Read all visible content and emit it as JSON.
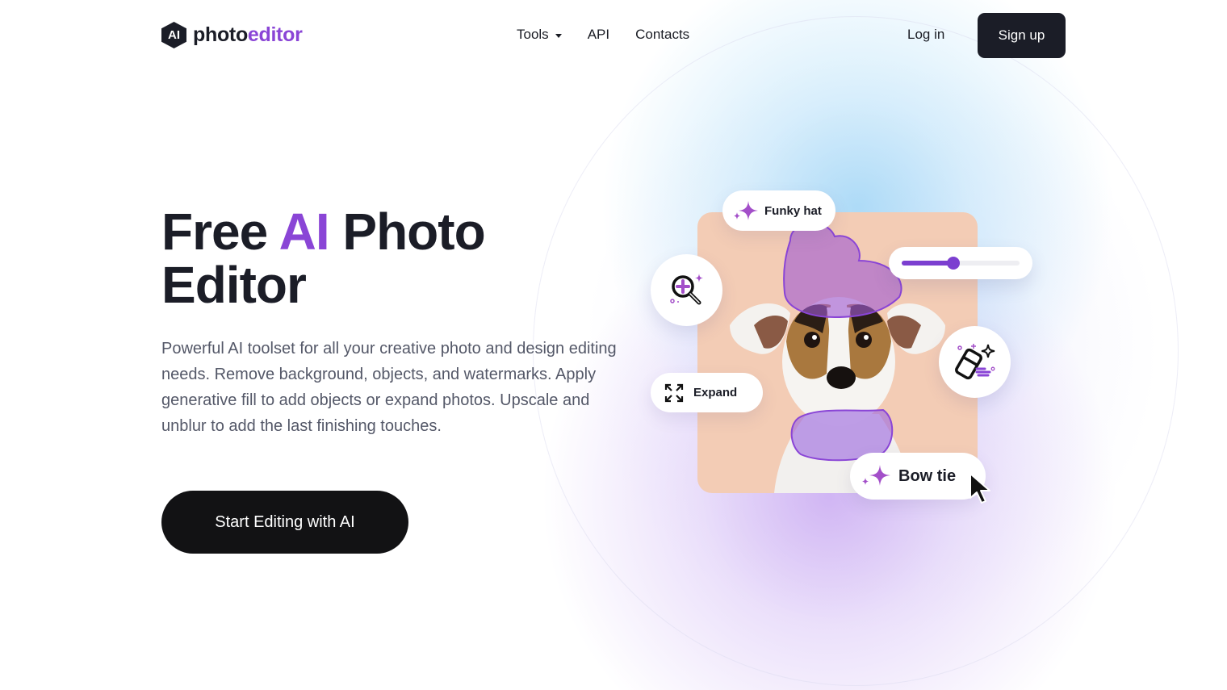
{
  "header": {
    "logo": {
      "badge": "AI",
      "name_part1": "photo",
      "name_part2": "editor"
    },
    "nav": [
      {
        "label": "Tools",
        "has_dropdown": true
      },
      {
        "label": "API"
      },
      {
        "label": "Contacts"
      }
    ],
    "login_label": "Log in",
    "signup_label": "Sign up"
  },
  "hero": {
    "title_part1": "Free ",
    "title_accent": "AI",
    "title_part2": " Photo",
    "title_line2": "Editor",
    "description": "Powerful AI toolset for all your creative photo and design editing needs. Remove background, objects, and watermarks. Apply generative fill to add objects or expand photos. Upscale and unblur to add the last finishing touches.",
    "cta_label": "Start Editing with AI"
  },
  "illustration": {
    "funky_hat_label": "Funky hat",
    "expand_label": "Expand",
    "bow_tie_label": "Bow tie",
    "slider_value_percent": 44,
    "icons": [
      "sparkle-icon",
      "magnifier-plus-icon",
      "eraser-icon",
      "expand-icon",
      "cursor-icon"
    ]
  },
  "colors": {
    "accent": "#8a45d6",
    "dark": "#1b1d27",
    "body_text": "#545868",
    "photo_bg": "#f3ccb5"
  }
}
